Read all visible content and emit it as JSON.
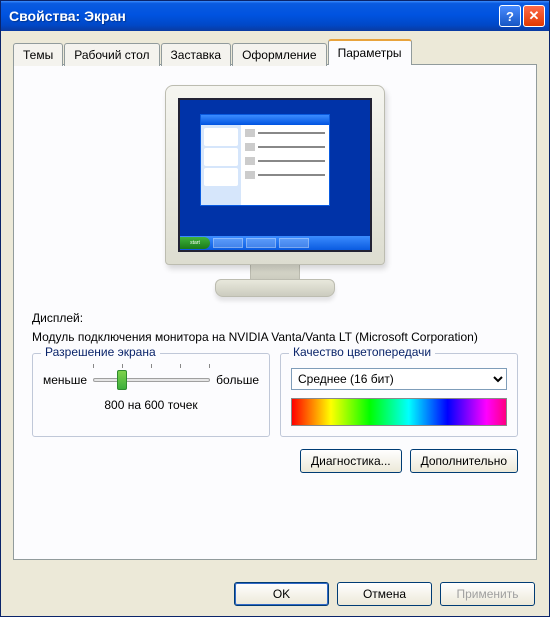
{
  "title": "Свойства: Экран",
  "tabs": [
    {
      "label": "Темы"
    },
    {
      "label": "Рабочий стол"
    },
    {
      "label": "Заставка"
    },
    {
      "label": "Оформление"
    },
    {
      "label": "Параметры"
    }
  ],
  "display": {
    "label": "Дисплей:",
    "value": "Модуль подключения монитора на NVIDIA Vanta/Vanta LT (Microsoft Corporation)"
  },
  "resolution": {
    "group_title": "Разрешение экрана",
    "less": "меньше",
    "more": "больше",
    "current": "800 на 600 точек"
  },
  "color": {
    "group_title": "Качество цветопередачи",
    "selected": "Среднее (16 бит)"
  },
  "buttons": {
    "troubleshoot": "Диагностика...",
    "advanced": "Дополнительно",
    "ok": "OK",
    "cancel": "Отмена",
    "apply": "Применить"
  },
  "start": "start"
}
